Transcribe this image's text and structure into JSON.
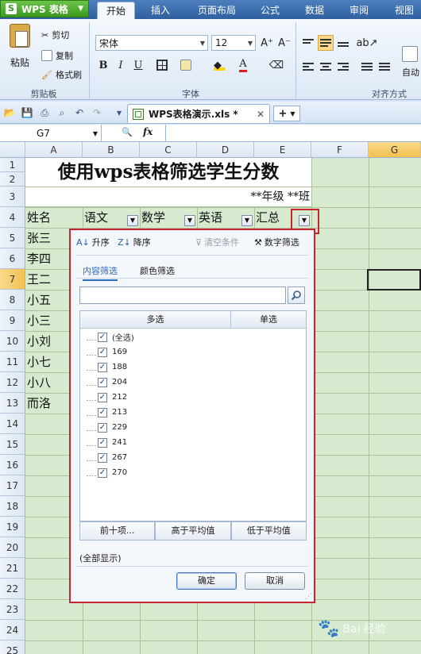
{
  "app": {
    "name": "WPS 表格",
    "logo_letter": "S"
  },
  "tabs": [
    "开始",
    "插入",
    "页面布局",
    "公式",
    "数据",
    "审阅",
    "视图"
  ],
  "ribbon": {
    "clipboard": {
      "paste": "粘贴",
      "cut": "剪切",
      "copy": "复制",
      "format_painter": "格式刷",
      "label": "剪贴板"
    },
    "font": {
      "name": "宋体",
      "size": "12",
      "bold": "B",
      "italic": "I",
      "underline": "U",
      "grow": "A⁺",
      "shrink": "A⁻",
      "label": "字体"
    },
    "align": {
      "wrap": "自动",
      "label": "对齐方式"
    }
  },
  "document": {
    "filename": "WPS表格演示.xls *"
  },
  "formula_bar": {
    "cell_ref": "G7",
    "fx": "fx"
  },
  "sheet": {
    "columns": [
      "A",
      "B",
      "C",
      "D",
      "E",
      "F",
      "G"
    ],
    "rows": [
      "1",
      "2",
      "3",
      "4",
      "5",
      "6",
      "7",
      "8",
      "9",
      "10",
      "11",
      "12",
      "13",
      "14",
      "15",
      "16",
      "17",
      "18",
      "19",
      "20",
      "21",
      "22",
      "23",
      "24",
      "25"
    ],
    "title": "使用wps表格筛选学生分数",
    "subtitle": "**年级 **班",
    "headers": [
      "姓名",
      "语文",
      "数学",
      "英语",
      "汇总"
    ],
    "names": [
      "张三",
      "李四",
      "王二",
      "小五",
      "小三",
      "小刘",
      "小七",
      "小八",
      "而洛"
    ]
  },
  "filter_panel": {
    "sort_asc": "升序",
    "sort_desc": "降序",
    "clear": "清空条件",
    "number_filter": "数字筛选",
    "tab_content": "内容筛选",
    "tab_color": "颜色筛选",
    "search_value": "",
    "col_multi": "多选",
    "col_single": "单选",
    "items": [
      {
        "label": "(全选)",
        "checked": "✓"
      },
      {
        "label": "169",
        "checked": "✓"
      },
      {
        "label": "188",
        "checked": "✓"
      },
      {
        "label": "204",
        "checked": "✓"
      },
      {
        "label": "212",
        "checked": "✓"
      },
      {
        "label": "213",
        "checked": "✓"
      },
      {
        "label": "229",
        "checked": "✓"
      },
      {
        "label": "241",
        "checked": "✓"
      },
      {
        "label": "267",
        "checked": "✓"
      },
      {
        "label": "270",
        "checked": "✓"
      }
    ],
    "top10": "前十项...",
    "above_avg": "高于平均值",
    "below_avg": "低于平均值",
    "show_all": "(全部显示)",
    "ok": "确定",
    "cancel": "取消"
  },
  "watermark": "Bai 经验"
}
